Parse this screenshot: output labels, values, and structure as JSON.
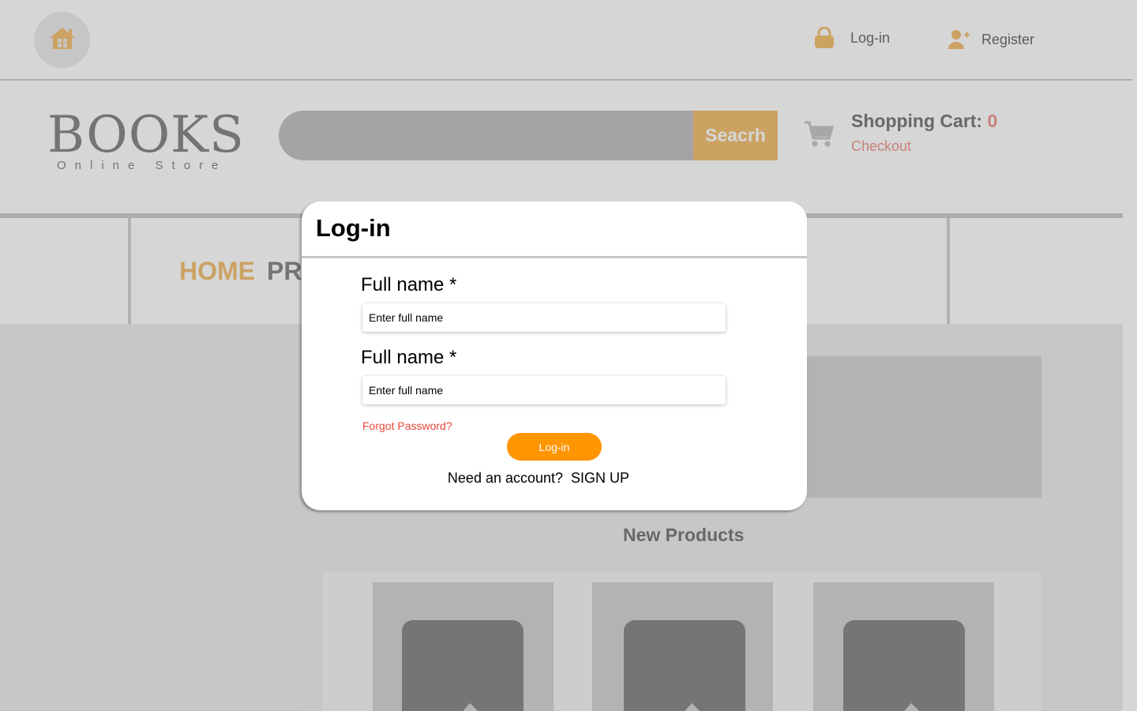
{
  "topbar": {
    "login_label": "Log-in",
    "register_label": "Register",
    "icons": [
      "home-icon",
      "lock-icon",
      "user-plus-icon"
    ]
  },
  "header": {
    "logo_title": "BOOKS",
    "logo_subtitle": "Online Store",
    "search_placeholder": "",
    "search_button": "Seacrh",
    "cart_label": "Shopping Cart:",
    "cart_count": "0",
    "checkout_label": "Checkout"
  },
  "nav": {
    "home_label": "HOME",
    "products_label_visible": "PR"
  },
  "main": {
    "new_products_title": "New Products"
  },
  "modal": {
    "title": "Log-in",
    "field1_label": "Full name *",
    "field1_placeholder": "Enter full name",
    "field2_label": "Full name *",
    "field2_placeholder": "Enter full name",
    "forgot_label": "Forgot Password?",
    "login_button": "Log-in",
    "signup_prompt": "Need an account?",
    "signup_link": "SIGN UP"
  },
  "colors": {
    "accent_orange": "#ff9500",
    "accent_tan": "#f4c277",
    "link_red": "#e8463a",
    "checkout_pink": "#f09a92"
  }
}
